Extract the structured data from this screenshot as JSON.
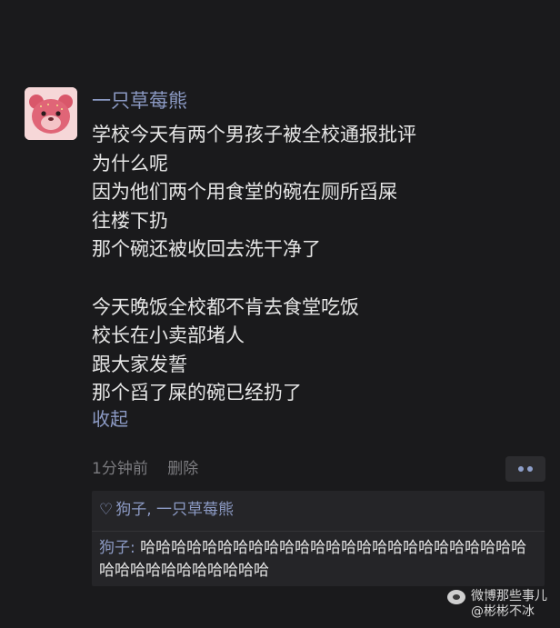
{
  "post": {
    "author": "一只草莓熊",
    "lines": [
      "学校今天有两个男孩子被全校通报批评",
      "为什么呢",
      "因为他们两个用食堂的碗在厕所舀屎",
      "往楼下扔",
      "那个碗还被收回去洗干净了",
      "",
      "今天晚饭全校都不肯去食堂吃饭",
      "校长在小卖部堵人",
      "跟大家发誓",
      "那个舀了屎的碗已经扔了"
    ],
    "collapse_label": "收起",
    "time": "1分钟前",
    "delete_label": "删除"
  },
  "likes": {
    "icon": "heart-outline-icon",
    "text": "狗子, 一只草莓熊"
  },
  "comment": {
    "author": "狗子:",
    "text": "哈哈哈哈哈哈哈哈哈哈哈哈哈哈哈哈哈哈哈哈哈哈哈哈哈哈哈哈哈哈哈哈哈哈哈哈"
  },
  "watermark": {
    "line1": "微博那些事儿",
    "line2": "@彬彬不冰"
  }
}
